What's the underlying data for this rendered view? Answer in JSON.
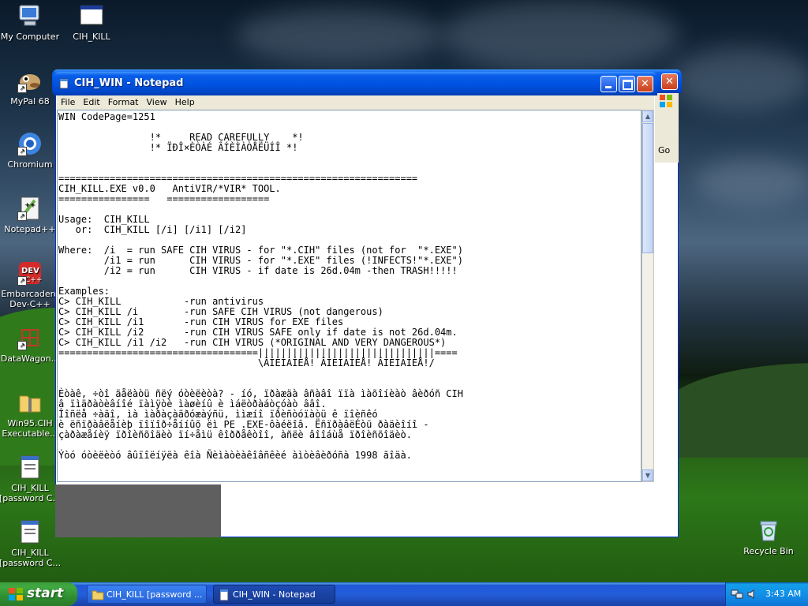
{
  "desktop_icons": [
    {
      "label": "My Computer",
      "icon": "my-computer-icon"
    },
    {
      "label": "CIH_KILL",
      "icon": "window-app-icon"
    },
    {
      "label": "MyPal 68",
      "icon": "mypal-browser-icon"
    },
    {
      "label": "Chromium",
      "icon": "chromium-icon"
    },
    {
      "label": "Notepad++",
      "icon": "notepadpp-icon"
    },
    {
      "label": "Embarcadero Dev-C++",
      "icon": "devcpp-icon"
    },
    {
      "label": "DataWagon...",
      "icon": "datawagon-icon"
    },
    {
      "label": "Win95.CIH Executable...",
      "icon": "zip-folder-icon"
    },
    {
      "label": "CIH_KILL [password C...",
      "icon": "text-file-icon"
    },
    {
      "label": "CIH_KILL [password C...",
      "icon": "text-file-icon"
    },
    {
      "label": "Recycle Bin",
      "icon": "recycle-bin-icon"
    }
  ],
  "background_window": {
    "go_label": "Go"
  },
  "notepad": {
    "title": "CIH_WIN - Notepad",
    "menu": [
      "File",
      "Edit",
      "Format",
      "View",
      "Help"
    ],
    "content": "WIN CodePage=1251\n\n                !*     READ CAREFULLY    *!\n                !* ÏÐÎ×ÈÒÀÉ ÂÍÈÌÀÒÅËÜÍÎ *!\n\n\n===============================================================\nCIH_KILL.EXE v0.0   AntiVIR/*VIR* TOOL.\n================   ==================\n\nUsage:  CIH_KILL\n   or:  CIH_KILL [/i] [/i1] [/i2]\n\nWhere:  /i  = run SAFE CIH VIRUS - for \"*.CIH\" files (not for  \"*.EXE\")\n        /i1 = run      CIH VIRUS - for \"*.EXE\" files (!INFECTS!\"*.EXE\")\n        /i2 = run      CIH VIRUS - if date is 26d.04m -then TRASH!!!!!\n\nExamples:\nC> CIH_KILL           -run antivirus\nC> CIH_KILL /i        -run SAFE CIH VIRUS (not dangerous)\nC> CIH_KILL /i1       -run CIH VIRUS for EXE files\nC> CIH_KILL /i2       -run CIH VIRUS SAFE only if date is not 26d.04m.\nC> CIH_KILL /i1 /i2   -run CIH VIRUS (*ORIGINAL AND VERY DANGEROUS*)\n===================================|||||||||||||||||||||||||||||||====\n                                   \\ÂÍÈÌÀÍÈÅ! ÂÍÈÌÀÍÈÅ! ÂÍÈÌÀÍÈÅ!/\n\n\nÈòàê, ÷òî äåëàòü ñëý óòèëèòà? - íó, ïðàæäà âñàâî ïïà ìàõîíèàò âèðóñ CIH\nâ ïìäðàòèâíîé ïàìÿòè ìàøèíû è ìáëòðàáòçóàò ââî.\nÎîñëå ÷àãî, ìà ìàðàçàãðóæàýñü, ììæíî ïðèñòóïàòü ê ïîèñêó\nè ëñïðàâëåíèþ ïîïîð÷åííûõ ëì PE .EXE-ôàéëîâ. ËñïðàâëÉòü ðàäèîíî -\nçàðàæåíèÿ ïðîèñõîäèò ïí÷åìü êîððåêòîî, àñëè âîîáùå ïðîèñõîäèò.\n\nÝòó óòèëèòó âûïîëíÿëà êîà Ñèìàòèàêîâñêèé àìòèâèðóñà 1998 ãîäà."
  },
  "taskbar": {
    "start_label": "start",
    "buttons": [
      {
        "label": "CIH_KILL [password ...",
        "icon": "folder-icon"
      },
      {
        "label": "CIH_WIN - Notepad",
        "icon": "notepad-icon"
      }
    ],
    "clock": "3:43 AM"
  }
}
